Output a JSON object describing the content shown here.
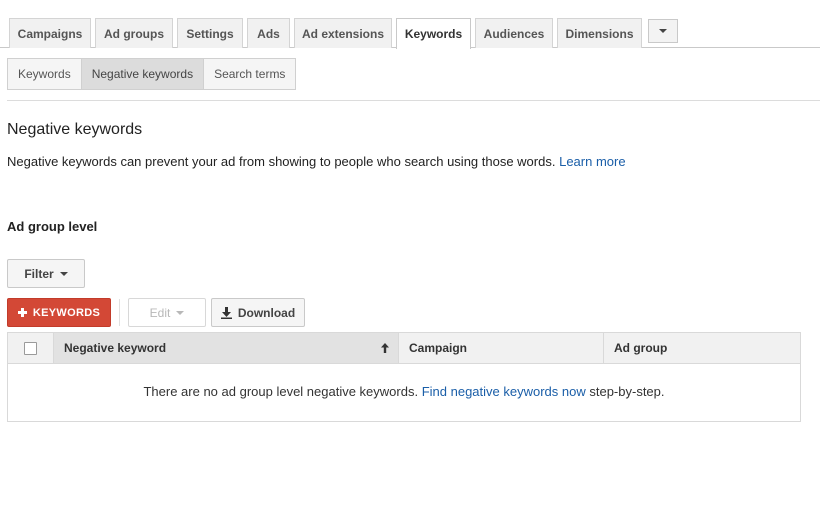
{
  "tabs": [
    {
      "label": "Campaigns",
      "active": false
    },
    {
      "label": "Ad groups",
      "active": false
    },
    {
      "label": "Settings",
      "active": false
    },
    {
      "label": "Ads",
      "active": false
    },
    {
      "label": "Ad extensions",
      "active": false
    },
    {
      "label": "Keywords",
      "active": true
    },
    {
      "label": "Audiences",
      "active": false
    },
    {
      "label": "Dimensions",
      "active": false
    }
  ],
  "subtabs": [
    {
      "label": "Keywords",
      "active": false
    },
    {
      "label": "Negative keywords",
      "active": true
    },
    {
      "label": "Search terms",
      "active": false
    }
  ],
  "page": {
    "title": "Negative keywords",
    "description": "Negative keywords can prevent your ad from showing to people who search using those words.",
    "learn_more": "Learn more"
  },
  "section": {
    "title": "Ad group level"
  },
  "toolbar": {
    "filter_label": "Filter",
    "add_label": "KEYWORDS",
    "edit_label": "Edit",
    "download_label": "Download"
  },
  "table": {
    "columns": [
      "Negative keyword",
      "Campaign",
      "Ad group"
    ],
    "sorted_column": "Negative keyword",
    "sort_direction": "ascending",
    "empty_prefix": "There are no ad group level negative keywords.",
    "empty_link": "Find negative keywords now",
    "empty_suffix": "step-by-step."
  },
  "colors": {
    "accent_red": "#d34836",
    "link_blue": "#1a5ea8"
  }
}
